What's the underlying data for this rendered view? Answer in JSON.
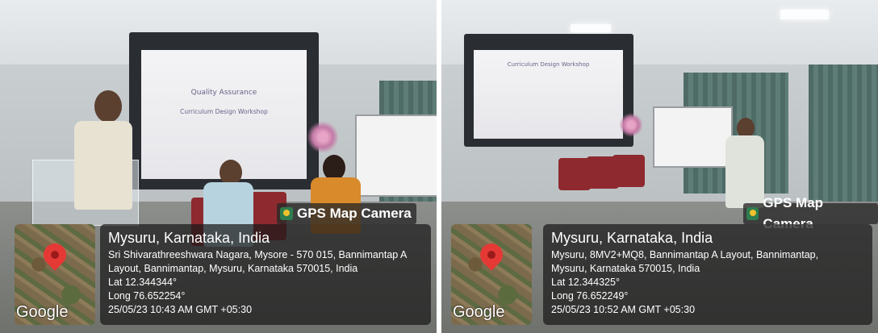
{
  "photos": [
    {
      "slide_lines": [
        "Quality Assurance",
        "Curriculum Design Workshop"
      ],
      "badge": "GPS Map Camera",
      "map_label": "Google",
      "city": "Mysuru, Karnataka, India",
      "address_line1": "Sri Shivarathreeshwara Nagara, Mysore - 570 015, Bannimantap A",
      "address_line2": "Layout, Bannimantap, Mysuru, Karnataka 570015, India",
      "lat": "Lat 12.344344°",
      "long": "Long 76.652254°",
      "datetime": "25/05/23 10:43 AM GMT +05:30"
    },
    {
      "slide_lines": [
        "Curriculum Design Workshop"
      ],
      "badge": "GPS Map Camera",
      "map_label": "Google",
      "city": "Mysuru, Karnataka, India",
      "address_line1": "Mysuru, 8MV2+MQ8, Bannimantap A Layout, Bannimantap,",
      "address_line2": "Mysuru, Karnataka 570015, India",
      "lat": "Lat 12.344325°",
      "long": "Long 76.652249°",
      "datetime": "25/05/23 10:52 AM GMT +05:30"
    }
  ],
  "icons": {
    "badge_icon": "map-camera-icon",
    "map_pin": "location-pin-icon"
  }
}
